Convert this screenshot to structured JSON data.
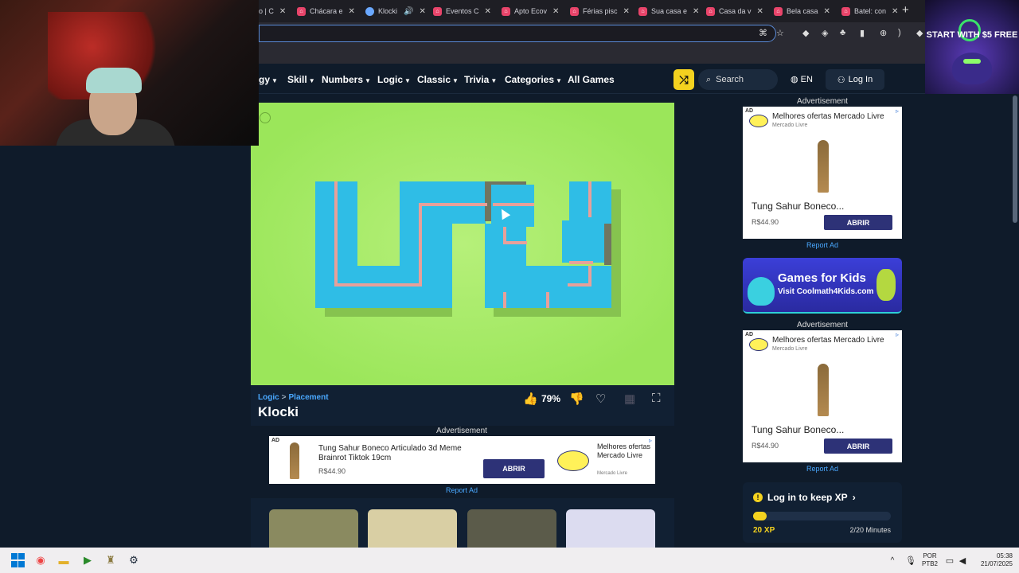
{
  "browser": {
    "tabs": [
      {
        "label": "o | C",
        "active": false
      },
      {
        "label": "Chácara e",
        "active": false
      },
      {
        "label": "Klocki",
        "active": true
      },
      {
        "label": "Eventos C",
        "active": false
      },
      {
        "label": "Apto Ecov",
        "active": false
      },
      {
        "label": "Férias pisc",
        "active": false
      },
      {
        "label": "Sua casa e",
        "active": false
      },
      {
        "label": "Casa da v",
        "active": false
      },
      {
        "label": "Bela casa",
        "active": false
      },
      {
        "label": "Batel: con",
        "active": false
      }
    ],
    "new_tab": "+"
  },
  "stream_ad": {
    "text": "START WITH $5 FREE"
  },
  "nav": {
    "items": [
      {
        "label": "gy"
      },
      {
        "label": "Skill"
      },
      {
        "label": "Numbers"
      },
      {
        "label": "Logic"
      },
      {
        "label": "Classic"
      },
      {
        "label": "Trivia"
      },
      {
        "label": "Categories"
      }
    ],
    "all_games": "All Games",
    "search_placeholder": "Search",
    "language": "EN",
    "login": "Log In"
  },
  "game": {
    "breadcrumb_parent": "Logic",
    "breadcrumb_sep": ">",
    "breadcrumb_child": "Placement",
    "title": "Klocki",
    "rating": "79%"
  },
  "ads": {
    "label": "Advertisement",
    "report": "Report Ad",
    "tag": "AD",
    "sidebar": {
      "title": "Melhores ofertas Mercado Livre",
      "brand": "Mercado Livre",
      "product": "Tung Sahur Boneco...",
      "price": "R$44.90",
      "button": "ABRIR"
    },
    "banner": {
      "product": "Tung Sahur Boneco Articulado 3d Meme Brainrot Tiktok 19cm",
      "price": "R$44.90",
      "button": "ABRIR",
      "brand_title": "Melhores ofertas Mercado Livre",
      "brand_small": "Mercado Livre"
    }
  },
  "kids_banner": {
    "title": "Games for Kids",
    "subtitle": "Visit Coolmath4Kids.com"
  },
  "xp": {
    "title": "Log in to keep XP",
    "value": "20 XP",
    "minutes": "2/20 Minutes",
    "progress": 0.1
  },
  "taskbar": {
    "lang_top": "POR",
    "lang_bottom": "PTB2",
    "time": "05:38",
    "date": "21/07/2025"
  }
}
